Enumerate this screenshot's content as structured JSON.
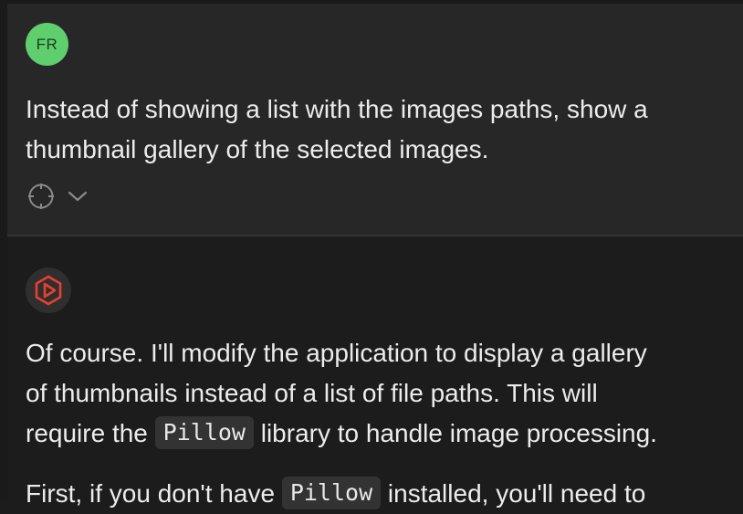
{
  "user_message": {
    "avatar_initials": "FR",
    "avatar_color": "#5fcf6d",
    "lines": [
      "Instead of showing a list with the images paths, show a",
      "thumbnail gallery of the selected images."
    ],
    "action_icons": [
      "crosshair-icon",
      "chevron-down-icon"
    ]
  },
  "assistant_message": {
    "avatar_icon": "assistant-logo-icon",
    "accent_color": "#e8402e",
    "line1": "Of course. I'll modify the application to display a gallery",
    "line2": "of thumbnails instead of a list of file paths. This will",
    "line3_pre": "require the ",
    "line3_code": "Pillow",
    "line3_post": " library to handle image processing.",
    "line4_pre": "First, if you don't have ",
    "line4_code": "Pillow",
    "line4_post": " installed, you'll need to"
  }
}
